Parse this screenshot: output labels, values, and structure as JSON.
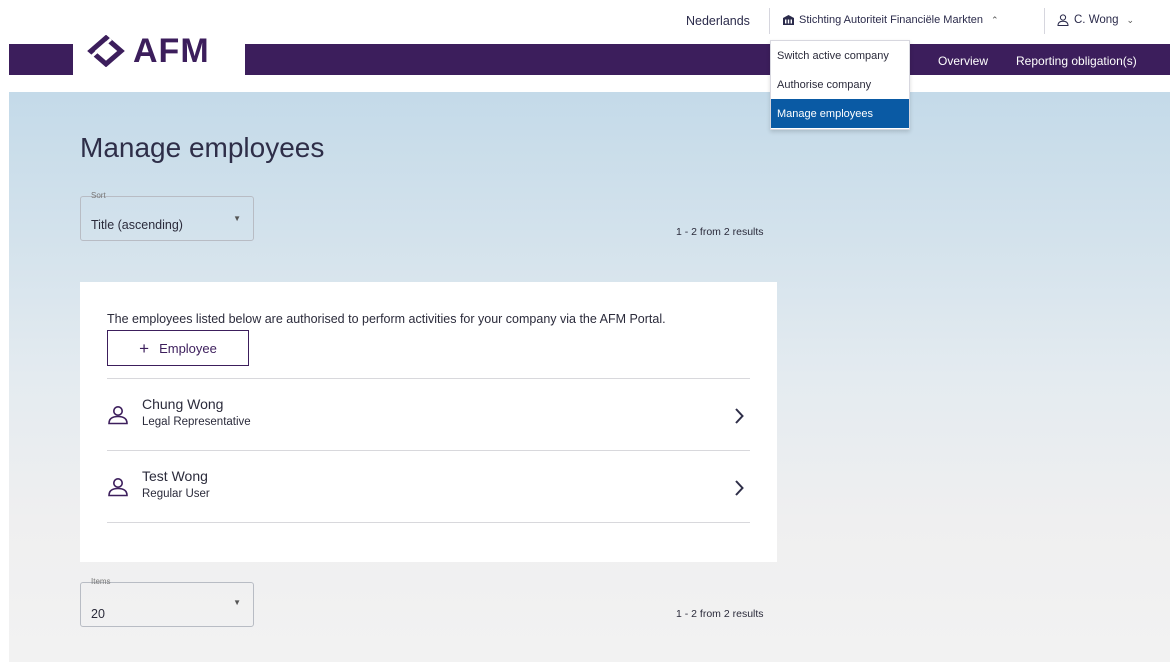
{
  "topbar": {
    "language": "Nederlands",
    "company": "Stichting Autoriteit Financiële Markten",
    "user": "C. Wong"
  },
  "brand": {
    "logo_text": "AFM",
    "color": "#3c1e5c"
  },
  "nav": {
    "overview": "Overview",
    "reporting": "Reporting obligation(s)"
  },
  "company_menu": {
    "items": [
      {
        "label": "Switch active company"
      },
      {
        "label": "Authorise company"
      },
      {
        "label": "Manage employees"
      }
    ],
    "active_color": "#0a5aa4"
  },
  "page": {
    "title": "Manage employees"
  },
  "sort": {
    "legend": "Sort",
    "value": "Title (ascending)"
  },
  "items": {
    "legend": "Items",
    "value": "20"
  },
  "results_text": "1 - 2 from 2 results",
  "card": {
    "intro": "The employees listed below are authorised to perform activities for your company via the AFM Portal.",
    "add_button": "Employee",
    "employees": [
      {
        "name": "Chung Wong",
        "role": "Legal Representative"
      },
      {
        "name": "Test Wong",
        "role": "Regular User"
      }
    ]
  },
  "icons": {
    "building": "building-icon",
    "user": "user-icon",
    "chevron": "chevron-right-icon",
    "plus": "plus-icon"
  }
}
